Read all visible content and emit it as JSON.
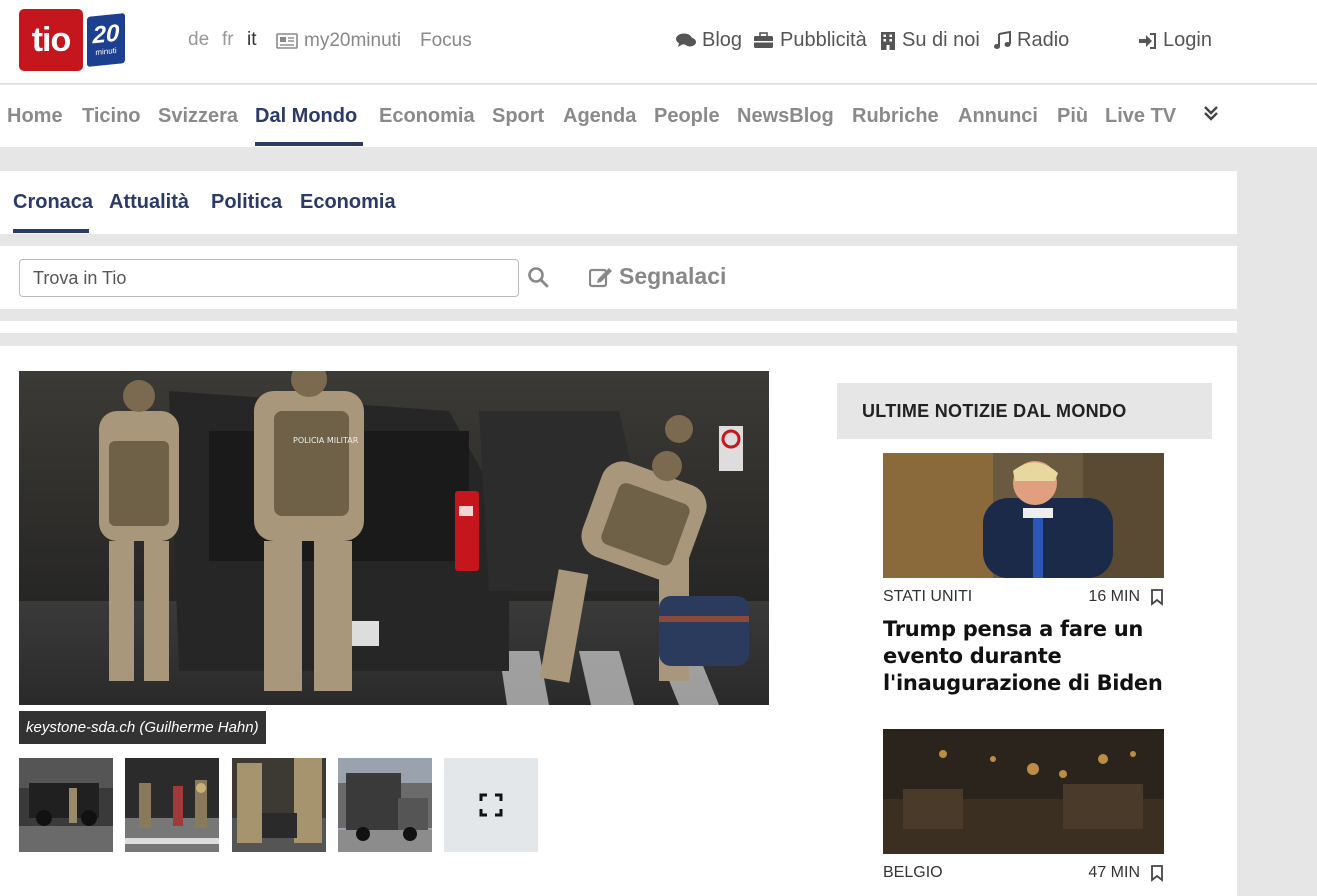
{
  "header": {
    "logo_tio": "tio",
    "logo_20": "20",
    "logo_20_sub": "minuti",
    "languages": [
      "de",
      "fr",
      "it"
    ],
    "active_language": "it",
    "my20minuti": "my20minuti",
    "focus": "Focus",
    "links": [
      {
        "label": "Blog",
        "icon": "comments-icon"
      },
      {
        "label": "Pubblicità",
        "icon": "briefcase-icon"
      },
      {
        "label": "Su di noi",
        "icon": "building-icon"
      },
      {
        "label": "Radio",
        "icon": "music-icon"
      }
    ],
    "login": "Login"
  },
  "main_nav": {
    "items": [
      "Home",
      "Ticino",
      "Svizzera",
      "Dal Mondo",
      "Economia",
      "Sport",
      "Agenda",
      "People",
      "NewsBlog",
      "Rubriche",
      "Annunci",
      "Più",
      "Live TV"
    ],
    "active": "Dal Mondo"
  },
  "sub_nav": {
    "items": [
      "Cronaca",
      "Attualità",
      "Politica",
      "Economia"
    ],
    "active": "Cronaca"
  },
  "search": {
    "placeholder": "Trova in Tio",
    "report_label": "Segnalaci"
  },
  "article": {
    "image_caption": "keystone-sda.ch (Guilherme Hahn)",
    "image_badges": [
      "POLICIA MILITAR"
    ]
  },
  "sidebar": {
    "heading": "ULTIME NOTIZIE DAL MONDO",
    "items": [
      {
        "category": "STATI UNITI",
        "time": "16 MIN",
        "title": "Trump pensa a fare un evento durante l'inaugurazione di Biden"
      },
      {
        "category": "BELGIO",
        "time": "47 MIN",
        "title": ""
      }
    ]
  },
  "colors": {
    "brand_red": "#c4161c",
    "brand_blue": "#1d3f8f",
    "nav_active": "#2b3a66"
  }
}
